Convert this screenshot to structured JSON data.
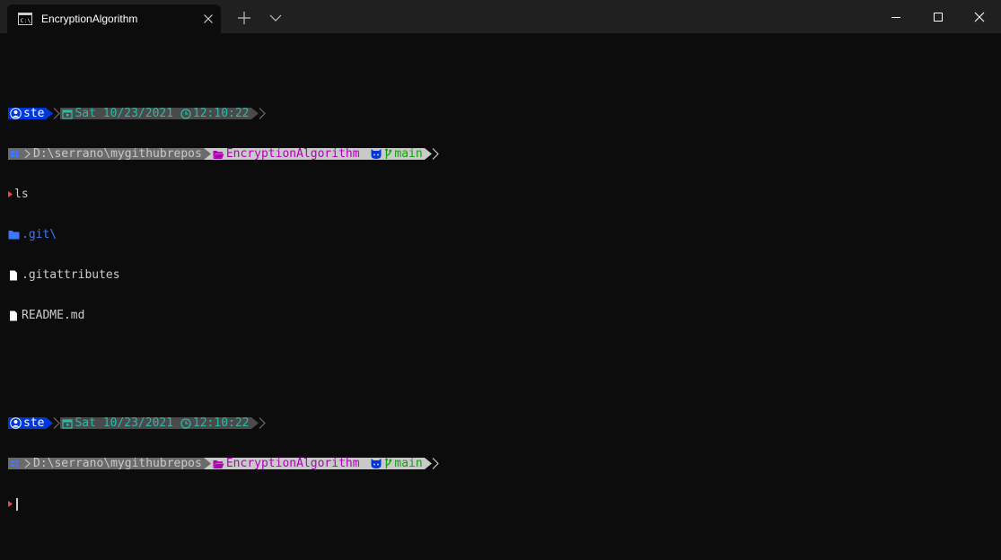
{
  "window": {
    "tab_title": "EncryptionAlgorithm",
    "tab_icon": "terminal-icon"
  },
  "colors": {
    "titlebar": "#202020",
    "terminal_bg": "#0c0c0c",
    "user_segment": "#0037da",
    "date_text": "#2eb8a8",
    "folder_text": "#b100b8",
    "git_text": "#13a10e",
    "prompt_char": "#e74856",
    "directory_text": "#3b78ff"
  },
  "prompts": [
    {
      "user": "ste",
      "date": "Sat 10/23/2021",
      "time": "12:10:22",
      "path": "D:\\serrano\\mygithubrepos",
      "folder": "EncryptionAlgorithm",
      "branch": "main"
    },
    {
      "user": "ste",
      "date": "Sat 10/23/2021",
      "time": "12:10:22",
      "path": "D:\\serrano\\mygithubrepos",
      "folder": "EncryptionAlgorithm",
      "branch": "main"
    }
  ],
  "command": "ls",
  "listing": [
    {
      "name": ".git\\",
      "kind": "directory",
      "icon": "folder-icon"
    },
    {
      "name": ".gitattributes",
      "kind": "file",
      "icon": "file-icon"
    },
    {
      "name": "README.md",
      "kind": "file",
      "icon": "file-icon"
    }
  ]
}
